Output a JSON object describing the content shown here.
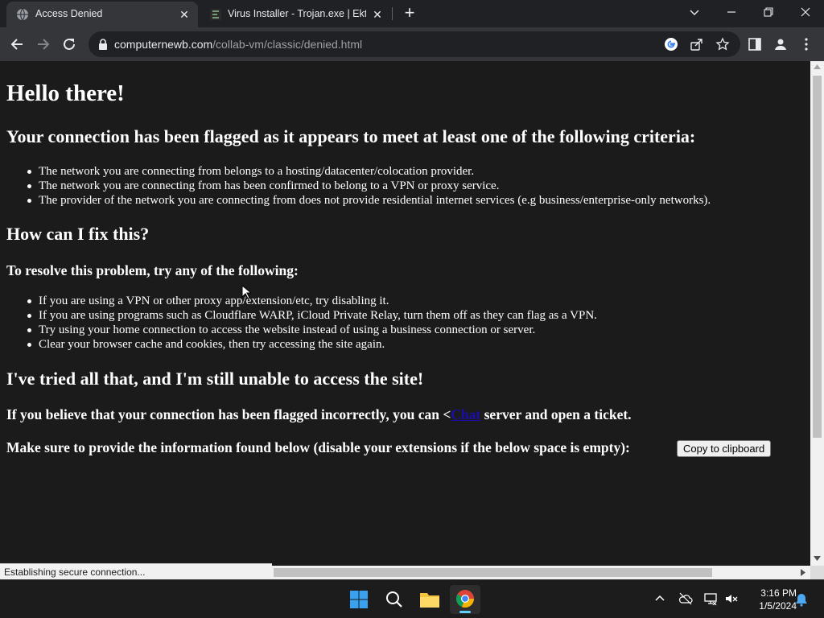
{
  "tabs": [
    {
      "title": "Access Denied",
      "icon": "globe-icon"
    },
    {
      "title": "Virus Installer - Trojan.exe | Ektoplasm",
      "icon": "site-icon"
    }
  ],
  "address": {
    "host": "computernewb.com",
    "path": "/collab-vm/classic/denied.html"
  },
  "page": {
    "h1": "Hello there!",
    "criteria_heading": "Your connection has been flagged as it appears to meet at least one of the following criteria:",
    "criteria": [
      "The network you are connecting from belongs to a hosting/datacenter/colocation provider.",
      "The network you are connecting from has been confirmed to belong to a VPN or proxy service.",
      "The provider of the network you are connecting from does not provide residential internet services (e.g business/enterprise-only networks)."
    ],
    "fix_heading": "How can I fix this?",
    "resolve_heading": "To resolve this problem, try any of the following:",
    "fixes": [
      "If you are using a VPN or other proxy app/extension/etc, try disabling it.",
      "If you are using programs such as Cloudflare WARP, iCloud Private Relay, turn them off as they can flag as a VPN.",
      "Try using your home connection to access the website instead of using a business connection or server.",
      "Clear your browser cache and cookies, then try accessing the site again."
    ],
    "still_heading": "I've tried all that, and I'm still unable to access the site!",
    "incorrect_before": "If you believe that your connection has been flagged incorrectly, you can <",
    "incorrect_link": "Chat",
    "incorrect_after": " server and open a ticket.",
    "provide_text": "Make sure to provide the information found below (disable your extensions if the below space is empty):",
    "copy_button": "Copy to clipboard"
  },
  "status": "Establishing secure connection...",
  "clock": {
    "time": "3:16 PM",
    "date": "1/5/2024"
  },
  "colors": {
    "link": "#1a0dab",
    "page_bg": "#1b1b1b",
    "taskbar_accent": "#60cdff"
  }
}
